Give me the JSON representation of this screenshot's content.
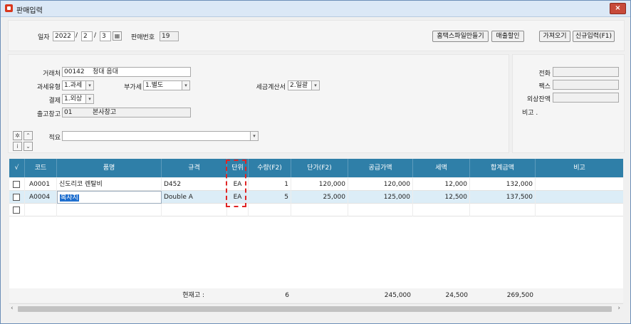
{
  "window": {
    "title": "판매입력",
    "close_label": "×"
  },
  "header": {
    "date_label": "일자",
    "year": "2022",
    "month": "2",
    "day": "3",
    "sep": "/",
    "sale_no_label": "판매번호",
    "sale_no": "19",
    "buttons": [
      "홈택스파일만들기",
      "매출할인",
      "가져오기",
      "신규입력(F1)"
    ]
  },
  "form": {
    "customer_label": "거래처",
    "customer_code": "00142",
    "customer_name": "청대 음대",
    "tax_type_label": "과세유형",
    "tax_type_value": "1.과세",
    "vat_label": "부가세",
    "vat_value": "1.별도",
    "invoice_label": "세금계산서",
    "invoice_value": "2.일괄",
    "payment_label": "결제",
    "payment_value": "1.외상",
    "warehouse_label": "출고창고",
    "warehouse_code": "01",
    "warehouse_name": "본사창고",
    "memo_label": "적요",
    "memo_value": ""
  },
  "side": {
    "phone_label": "전화",
    "fax_label": "팩스",
    "balance_label": "외상잔액",
    "note_label": "비고 ."
  },
  "grid": {
    "columns": [
      "√",
      "코드",
      "품명",
      "규격",
      "단위",
      "수량(F2)",
      "단가(F2)",
      "공급가액",
      "세액",
      "합계금액",
      "비고"
    ],
    "rows": [
      {
        "code": "A0001",
        "name": "신도리코 렌탈비",
        "spec": "D452",
        "unit": "EA",
        "qty": "1",
        "price": "120,000",
        "supply": "120,000",
        "tax": "12,000",
        "total": "132,000",
        "note": ""
      },
      {
        "code": "A0004",
        "name": "복사지",
        "spec": "Double A",
        "unit": "EA",
        "qty": "5",
        "price": "25,000",
        "supply": "125,000",
        "tax": "12,500",
        "total": "137,500",
        "note": ""
      }
    ],
    "footer": {
      "label": "현재고 :",
      "qty": "6",
      "supply": "245,000",
      "tax": "24,500",
      "total": "269,500"
    }
  },
  "colors": {
    "header_bg": "#2f7fa8",
    "selected_row": "#dcedf7",
    "highlight": "#1f6fcf",
    "annotation": "#e02424"
  }
}
